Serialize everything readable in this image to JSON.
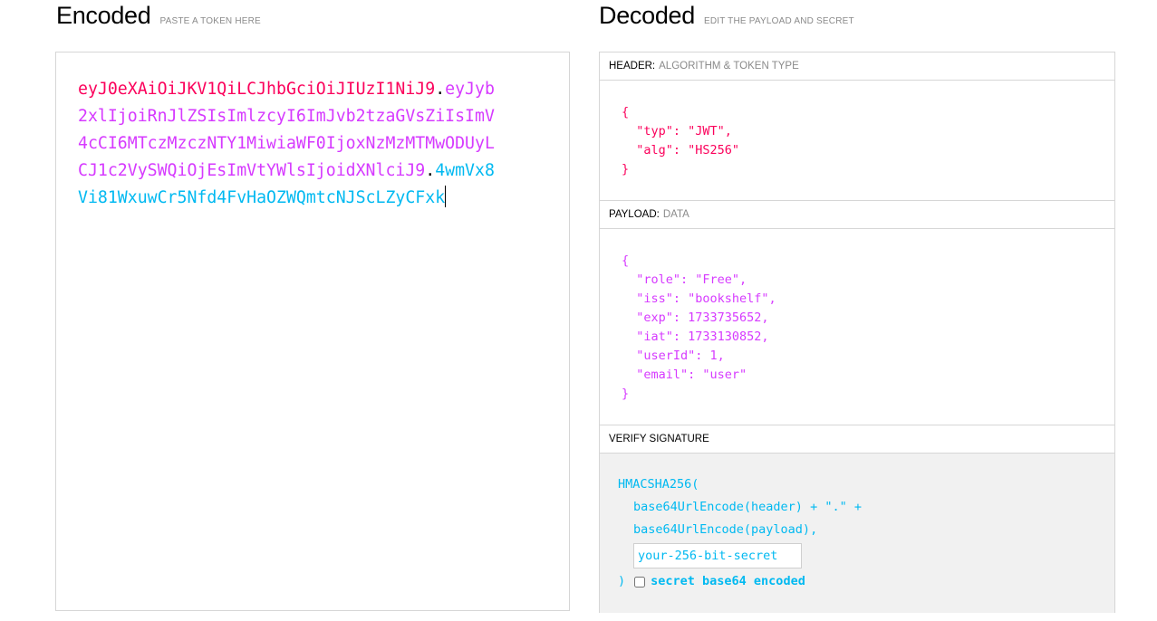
{
  "encoded": {
    "title": "Encoded",
    "subtitle": "PASTE A TOKEN HERE",
    "token_header": "eyJ0eXAiOiJKV1QiLCJhbGciOiJIUzI1NiJ9",
    "token_payload": "eyJyb2xlIjoiRnJlZSIsImlzcyI6ImJvb2tzaGVsZiIsImV4cCI6MTczMzczNTY1MiwiaWF0IjoxNzMzMTMwODUyLCJ1c2VySWQiOjEsImVtYWlsIjoidXNlciJ9",
    "token_signature": "4wmVx8Vi81WxuwCr5Nfd4FvHaOZWQmtcNJScLZyCFxk",
    "dot": "."
  },
  "decoded": {
    "title": "Decoded",
    "subtitle": "EDIT THE PAYLOAD AND SECRET",
    "header_section": {
      "label": "HEADER:",
      "sub": "ALGORITHM & TOKEN TYPE",
      "json": "{\n  \"typ\": \"JWT\",\n  \"alg\": \"HS256\"\n}"
    },
    "payload_section": {
      "label": "PAYLOAD:",
      "sub": "DATA",
      "json": "{\n  \"role\": \"Free\",\n  \"iss\": \"bookshelf\",\n  \"exp\": 1733735652,\n  \"iat\": 1733130852,\n  \"userId\": 1,\n  \"email\": \"user\"\n}"
    },
    "signature_section": {
      "label": "VERIFY SIGNATURE",
      "fn_open": "HMACSHA256(",
      "line1": "base64UrlEncode(header) + \".\" +",
      "line2": "base64UrlEncode(payload),",
      "secret_placeholder": "your-256-bit-secret",
      "close": ")",
      "checkbox_label": "secret base64 encoded"
    }
  },
  "colors": {
    "header": "#fb015b",
    "payload": "#d63aff",
    "signature": "#00b9f1"
  }
}
